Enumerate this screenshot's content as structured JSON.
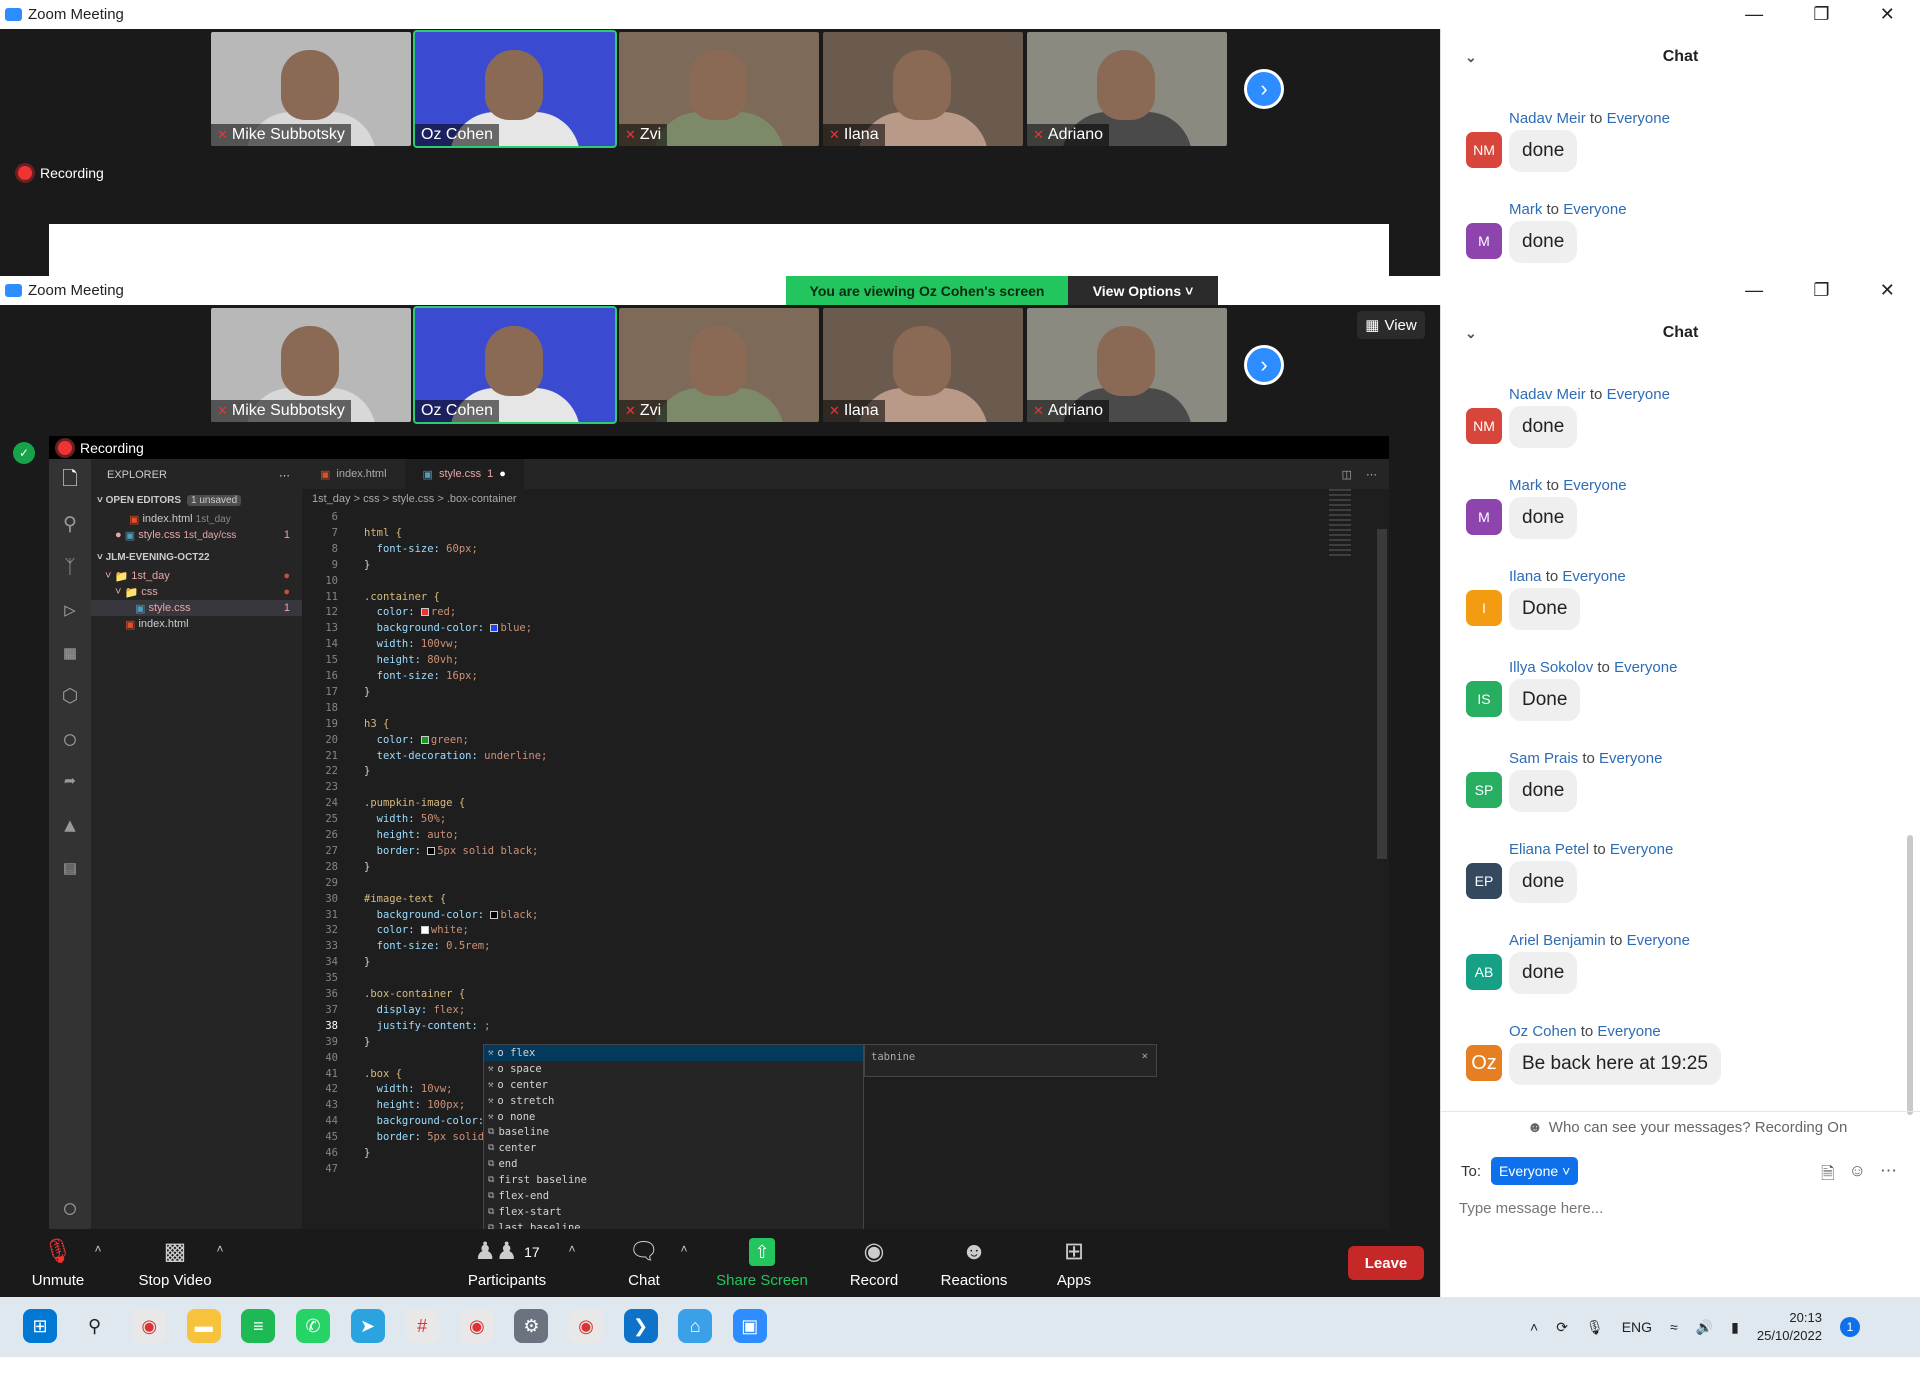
{
  "app": {
    "title": "Zoom Meeting"
  },
  "participants": [
    {
      "name": "Mike Subbotsky",
      "muted": true,
      "shirt": "#d8d8d8"
    },
    {
      "name": "Oz Cohen",
      "muted": false,
      "shirt": "#e6e6e6"
    },
    {
      "name": "Zvi",
      "muted": true,
      "shirt": "#7c8a6a"
    },
    {
      "name": "Ilana",
      "muted": true,
      "shirt": "#b99a88"
    },
    {
      "name": "Adriano",
      "muted": true,
      "shirt": "#4a4a4a"
    }
  ],
  "recording_label": "Recording",
  "share_banner": {
    "text": "You are viewing Oz Cohen's screen",
    "view_options": "View Options"
  },
  "view_label": "View",
  "chat": {
    "title": "Chat",
    "to_word": "to",
    "top_messages": [
      {
        "sender": "Nadav Meir",
        "recipient": "Everyone",
        "initials": "NM",
        "color": "#d8463b",
        "text": "done"
      },
      {
        "sender": "Mark",
        "recipient": "Everyone",
        "initials": "M",
        "color": "#8e44ad",
        "text": "done"
      }
    ],
    "messages": [
      {
        "sender": "Nadav Meir",
        "recipient": "Everyone",
        "initials": "NM",
        "color": "#d8463b",
        "text": "done"
      },
      {
        "sender": "Mark",
        "recipient": "Everyone",
        "initials": "M",
        "color": "#8e44ad",
        "text": "done"
      },
      {
        "sender": "Ilana",
        "recipient": "Everyone",
        "initials": "I",
        "color": "#f39c12",
        "text": "Done"
      },
      {
        "sender": "Illya Sokolov",
        "recipient": "Everyone",
        "initials": "IS",
        "color": "#27ae60",
        "text": "Done"
      },
      {
        "sender": "Sam Prais",
        "recipient": "Everyone",
        "initials": "SP",
        "color": "#27ae60",
        "text": "done"
      },
      {
        "sender": "Eliana Petel",
        "recipient": "Everyone",
        "initials": "EP",
        "color": "#34495e",
        "text": "done"
      },
      {
        "sender": "Ariel Benjamin",
        "recipient": "Everyone",
        "initials": "AB",
        "color": "#16a085",
        "text": "done"
      },
      {
        "sender": "Oz Cohen",
        "recipient": "Everyone",
        "initials": "Oz",
        "color": "#e67e22",
        "text": "Be back here at 19:25"
      }
    ],
    "visibility_note": "Who can see your messages? Recording On",
    "to_label": "To:",
    "to_value": "Everyone",
    "placeholder": "Type message here..."
  },
  "vscode": {
    "explorer_title": "EXPLORER",
    "open_editors": "OPEN EDITORS",
    "unsaved_badge": "1 unsaved",
    "open_files": [
      {
        "name": "index.html",
        "path": "1st_day"
      },
      {
        "name": "style.css",
        "path": "1st_day/css",
        "count": "1"
      }
    ],
    "workspace": "JLM-EVENING-OCT22",
    "tree": [
      "1st_day",
      "css",
      "style.css",
      "index.html"
    ],
    "tree_count": "1",
    "tabs": [
      {
        "label": "index.html"
      },
      {
        "label": "style.css",
        "count": "1"
      }
    ],
    "breadcrumb": [
      "1st_day",
      "css",
      "style.css",
      ".box-container"
    ],
    "code_lines": [
      {
        "n": "6",
        "t": ""
      },
      {
        "n": "7",
        "t": "html {",
        "k": "sel"
      },
      {
        "n": "8",
        "t": "  font-size: 60px;",
        "k": "prop"
      },
      {
        "n": "9",
        "t": "}"
      },
      {
        "n": "10",
        "t": ""
      },
      {
        "n": "11",
        "t": ".container {",
        "k": "sel"
      },
      {
        "n": "12",
        "t": "  color: red;",
        "k": "prop",
        "sw": "#e33"
      },
      {
        "n": "13",
        "t": "  background-color: blue;",
        "k": "prop",
        "sw": "#1e40ff"
      },
      {
        "n": "14",
        "t": "  width: 100vw;",
        "k": "prop"
      },
      {
        "n": "15",
        "t": "  height: 80vh;",
        "k": "prop"
      },
      {
        "n": "16",
        "t": "  font-size: 16px;",
        "k": "prop"
      },
      {
        "n": "17",
        "t": "}"
      },
      {
        "n": "18",
        "t": ""
      },
      {
        "n": "19",
        "t": "h3 {",
        "k": "sel"
      },
      {
        "n": "20",
        "t": "  color: green;",
        "k": "prop",
        "sw": "#1a9a1a"
      },
      {
        "n": "21",
        "t": "  text-decoration: underline;",
        "k": "prop"
      },
      {
        "n": "22",
        "t": "}"
      },
      {
        "n": "23",
        "t": ""
      },
      {
        "n": "24",
        "t": ".pumpkin-image {",
        "k": "sel"
      },
      {
        "n": "25",
        "t": "  width: 50%;",
        "k": "prop"
      },
      {
        "n": "26",
        "t": "  height: auto;",
        "k": "prop"
      },
      {
        "n": "27",
        "t": "  border: 5px solid black;",
        "k": "prop",
        "sw": "#000"
      },
      {
        "n": "28",
        "t": "}"
      },
      {
        "n": "29",
        "t": ""
      },
      {
        "n": "30",
        "t": "#image-text {",
        "k": "sel"
      },
      {
        "n": "31",
        "t": "  background-color: black;",
        "k": "prop",
        "sw": "#000"
      },
      {
        "n": "32",
        "t": "  color: white;",
        "k": "prop",
        "sw": "#fff"
      },
      {
        "n": "33",
        "t": "  font-size: 0.5rem;",
        "k": "prop"
      },
      {
        "n": "34",
        "t": "}"
      },
      {
        "n": "35",
        "t": ""
      },
      {
        "n": "36",
        "t": ".box-container {",
        "k": "sel"
      },
      {
        "n": "37",
        "t": "  display: flex;",
        "k": "prop"
      },
      {
        "n": "38",
        "t": "  justify-content: ;",
        "k": "prop"
      },
      {
        "n": "39",
        "t": "}"
      },
      {
        "n": "40",
        "t": ""
      },
      {
        "n": "41",
        "t": ".box {",
        "k": "sel"
      },
      {
        "n": "42",
        "t": "  width: 10vw;",
        "k": "prop"
      },
      {
        "n": "43",
        "t": "  height: 100px;",
        "k": "prop"
      },
      {
        "n": "44",
        "t": "  background-color:",
        "k": "prop"
      },
      {
        "n": "45",
        "t": "  border: 5px solid",
        "k": "prop"
      },
      {
        "n": "46",
        "t": "}"
      },
      {
        "n": "47",
        "t": ""
      }
    ],
    "suggestions": [
      "o flex",
      "o space",
      "o center",
      "o stretch",
      "o none",
      "baseline",
      "center",
      "end",
      "first baseline",
      "flex-end",
      "flex-start",
      "last baseline"
    ],
    "tabnine": "tabnine"
  },
  "toolbar": {
    "unmute": "Unmute",
    "stop_video": "Stop Video",
    "participants": "Participants",
    "participant_count": "17",
    "chat": "Chat",
    "share_screen": "Share Screen",
    "record": "Record",
    "reactions": "Reactions",
    "apps": "Apps",
    "leave": "Leave"
  },
  "taskbar": {
    "lang": "ENG",
    "time": "20:13",
    "date": "25/10/2022",
    "notif": "1",
    "apps": [
      "windows-start",
      "search",
      "chrome",
      "file-explorer",
      "spotify",
      "whatsapp",
      "telegram",
      "slack",
      "chrome-profile",
      "settings",
      "chrome",
      "vscode",
      "network-app",
      "zoom"
    ]
  }
}
